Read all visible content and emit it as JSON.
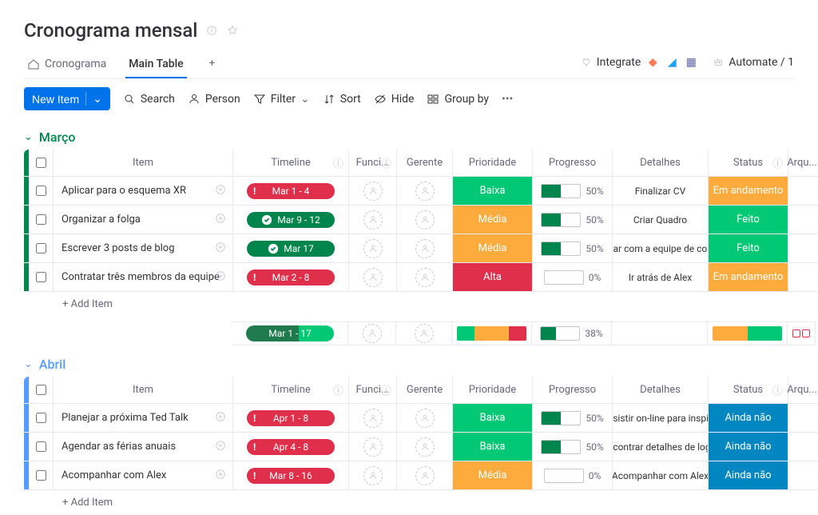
{
  "title": "Cronograma mensal",
  "tabs": {
    "main": "Cronograma",
    "table": "Main Table"
  },
  "actions": {
    "integrate": "Integrate",
    "automate": "Automate / 1"
  },
  "toolbar": {
    "newItem": "New Item",
    "search": "Search",
    "person": "Person",
    "filter": "Filter",
    "sort": "Sort",
    "hide": "Hide",
    "groupBy": "Group by"
  },
  "columns": {
    "item": "Item",
    "timeline": "Timeline",
    "funci": "Funci...",
    "gerente": "Gerente",
    "prioridade": "Prioridade",
    "progresso": "Progresso",
    "detalhes": "Detalhes",
    "status": "Status",
    "arq": "Arqu..."
  },
  "addItem": "+ Add Item",
  "groups": [
    {
      "name": "Março",
      "color": "green",
      "rows": [
        {
          "item": "Aplicar para o esquema XR",
          "timeline": "Mar 1 - 4",
          "tlColor": "red",
          "tlIcon": "!",
          "prioridade": "Baixa",
          "progresso": 50,
          "detalhes": "Finalizar CV",
          "status": "Em andamento",
          "stClass": "st-andamento"
        },
        {
          "item": "Organizar a folga",
          "timeline": "Mar 9 - 12",
          "tlColor": "green",
          "tlIcon": "check",
          "prioridade": "Média",
          "progresso": 50,
          "detalhes": "Criar Quadro",
          "status": "Feito",
          "stClass": "st-feito"
        },
        {
          "item": "Escrever 3 posts de blog",
          "timeline": "Mar 17",
          "tlColor": "green",
          "tlIcon": "check",
          "prioridade": "Média",
          "progresso": 50,
          "detalhes": "Falar com a equipe de con...",
          "status": "Feito",
          "stClass": "st-feito"
        },
        {
          "item": "Contratar três membros da equipe",
          "timeline": "Mar 2 - 8",
          "tlColor": "red",
          "tlIcon": "!",
          "prioridade": "Alta",
          "progresso": 0,
          "detalhes": "Ir atrás de Alex",
          "status": "Em andamento",
          "stClass": "st-andamento"
        }
      ],
      "summary": {
        "timeline": "Mar 1 - 17",
        "progresso": 38
      }
    },
    {
      "name": "Abril",
      "color": "blue",
      "rows": [
        {
          "item": "Planejar a próxima Ted Talk",
          "timeline": "Apr 1 - 8",
          "tlColor": "red",
          "tlIcon": "!",
          "prioridade": "Baixa",
          "progresso": 50,
          "detalhes": "Assistir on-line para inspir...",
          "status": "Ainda não",
          "stClass": "st-ainda"
        },
        {
          "item": "Agendar as férias anuais",
          "timeline": "Apr 4 - 8",
          "tlColor": "red",
          "tlIcon": "!",
          "prioridade": "Baixa",
          "progresso": 50,
          "detalhes": "Encontrar detalhes de login",
          "status": "Ainda não",
          "stClass": "st-ainda"
        },
        {
          "item": "Acompanhar com Alex",
          "timeline": "Mar 8 - 16",
          "tlColor": "red",
          "tlIcon": "!",
          "prioridade": "Média",
          "progresso": 0,
          "detalhes": "Acompanhar com Alex",
          "status": "Ainda não",
          "stClass": "st-ainda"
        }
      ]
    }
  ]
}
